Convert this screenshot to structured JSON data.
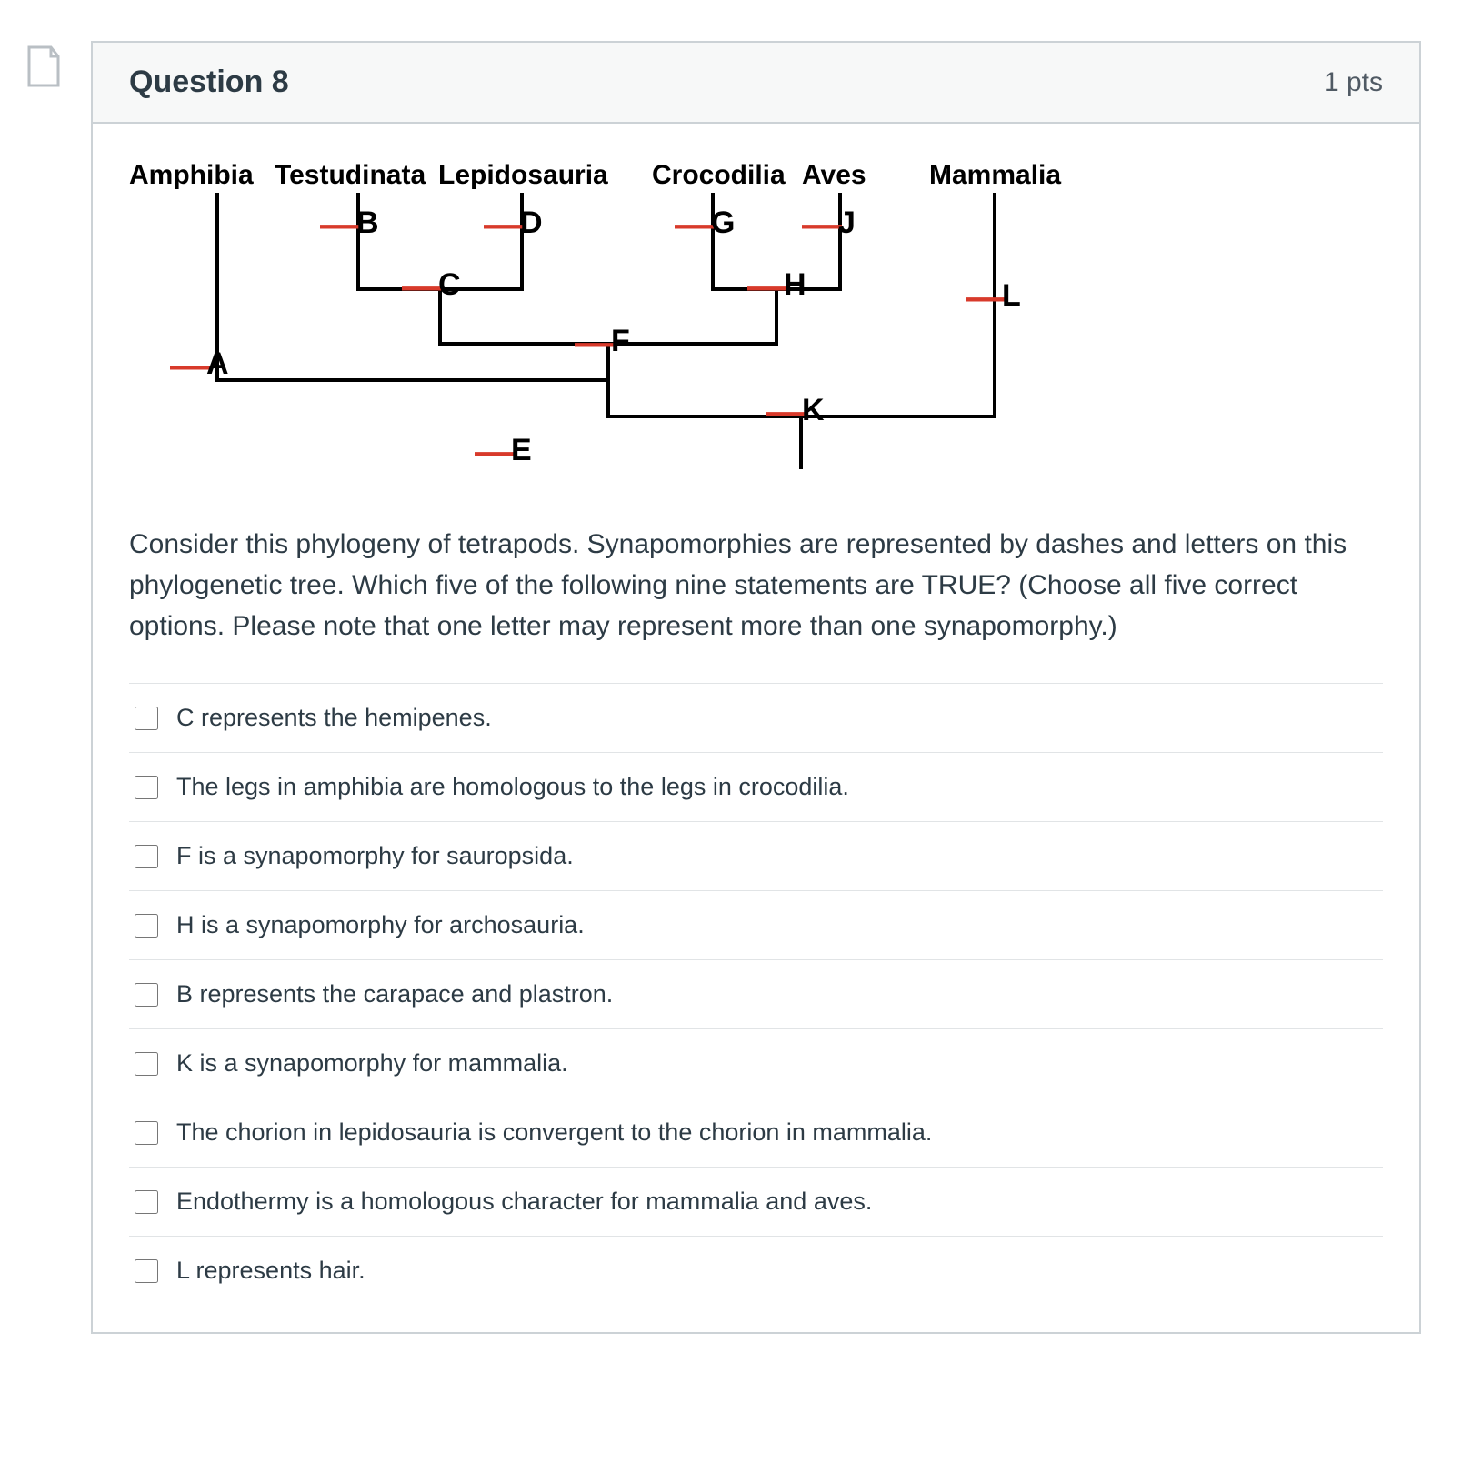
{
  "question": {
    "title": "Question 8",
    "points": "1 pts",
    "prompt": "Consider this phylogeny of tetrapods.  Synapomorphies are represented by dashes and letters on this phylogenetic tree.  Which five of the following nine statements are TRUE?  (Choose all five correct options.  Please note that one letter may represent more than one synapomorphy.)"
  },
  "taxa": {
    "t0": "Amphibia",
    "t1": "Testudinata",
    "t2": "Lepidosauria",
    "t3": "Crocodilia",
    "t4": "Aves",
    "t5": "Mammalia"
  },
  "marks": {
    "A": "A",
    "B": "B",
    "C": "C",
    "D": "D",
    "E": "E",
    "F": "F",
    "G": "G",
    "H": "H",
    "J": "J",
    "K": "K",
    "L": "L"
  },
  "options": {
    "o0": "C represents the hemipenes.",
    "o1": "The legs in amphibia are homologous to the legs in crocodilia.",
    "o2": "F is a synapomorphy for sauropsida.",
    "o3": "H is a synapomorphy for archosauria.",
    "o4": "B represents the carapace and plastron.",
    "o5": "K is a synapomorphy for mammalia.",
    "o6": "The chorion in lepidosauria is convergent to the chorion in mammalia.",
    "o7": "Endothermy is a homologous character for mammalia and aves.",
    "o8": "L represents hair."
  }
}
